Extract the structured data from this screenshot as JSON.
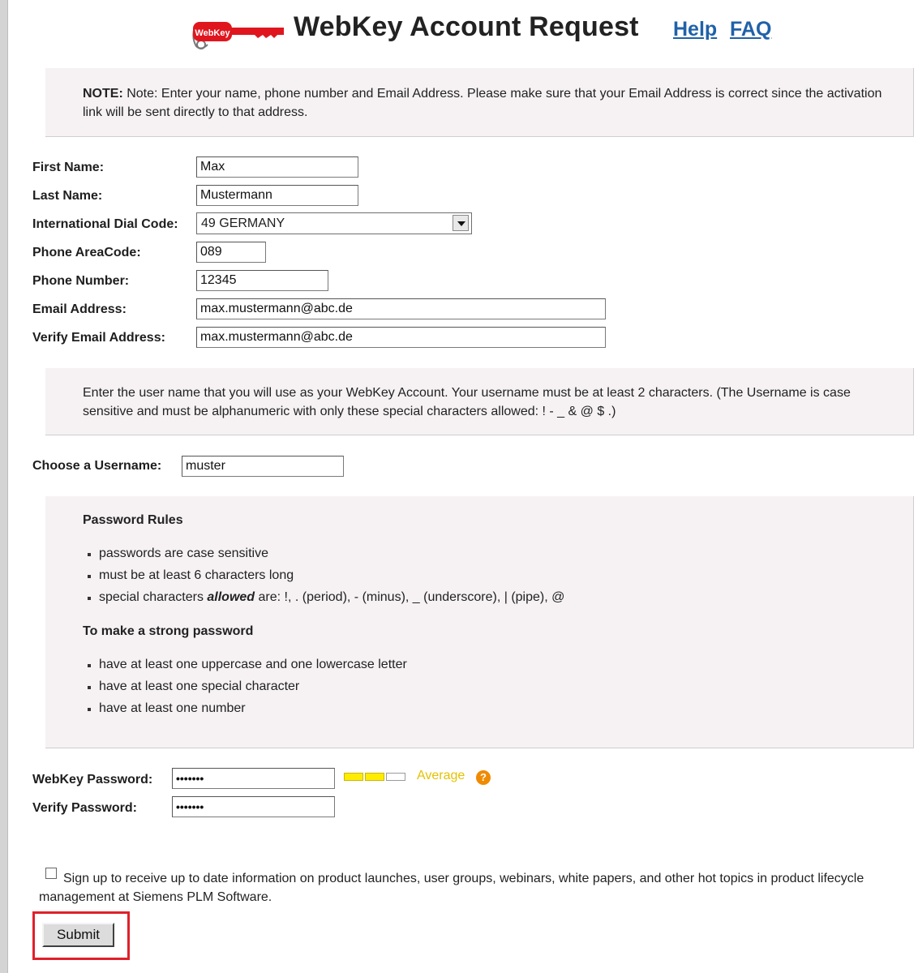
{
  "header": {
    "logo_text": "WebKey",
    "title": "WebKey Account Request",
    "help_link": "Help",
    "faq_link": "FAQ"
  },
  "note_box": {
    "prefix": "NOTE:",
    "text": " Note: Enter your name, phone number and Email Address. Please make sure that your Email Address is correct since the activation link will be sent directly to that address."
  },
  "form": {
    "first_name": {
      "label": "First Name:",
      "value": "Max"
    },
    "last_name": {
      "label": "Last Name:",
      "value": "Mustermann"
    },
    "dial_code": {
      "label": "International Dial Code:",
      "value": "49 GERMANY"
    },
    "area_code": {
      "label": "Phone AreaCode:",
      "value": "089"
    },
    "phone_number": {
      "label": "Phone Number:",
      "value": "12345"
    },
    "email": {
      "label": "Email Address:",
      "value": "max.mustermann@abc.de"
    },
    "verify_email": {
      "label": "Verify Email Address:",
      "value": "max.mustermann@abc.de"
    }
  },
  "username_box": {
    "text": "Enter the user name that you will use as your WebKey Account. Your username must be at least 2 characters. (The Username is case sensitive and must be alphanumeric with only these special characters allowed: ! - _ & @ $ .)"
  },
  "username": {
    "label": "Choose a Username:",
    "value": "muster"
  },
  "password_rules": {
    "heading": "Password Rules",
    "rules": [
      "passwords are case sensitive",
      "must be at least 6 characters long"
    ],
    "rule3_prefix": "special characters ",
    "rule3_emph": "allowed",
    "rule3_suffix": " are: !, . (period), - (minus), _ (underscore), | (pipe), @",
    "strong_heading": "To make a strong password",
    "strong_rules": [
      "have at least one uppercase and one lowercase letter",
      "have at least one special character",
      "have at least one number"
    ]
  },
  "password": {
    "label": "WebKey Password:",
    "value": "•••••••",
    "verify_label": "Verify Password:",
    "verify_value": "•••••••",
    "strength_label": "Average",
    "strength_level": 2,
    "strength_max": 3,
    "strength_color": "#ffec00",
    "help_icon": "question-circle-icon"
  },
  "signup": {
    "checked": false,
    "text": "Sign up to receive up to date information on product launches, user groups, webinars, white papers, and other hot topics in product lifecycle management at Siemens PLM Software."
  },
  "submit_label": "Submit"
}
